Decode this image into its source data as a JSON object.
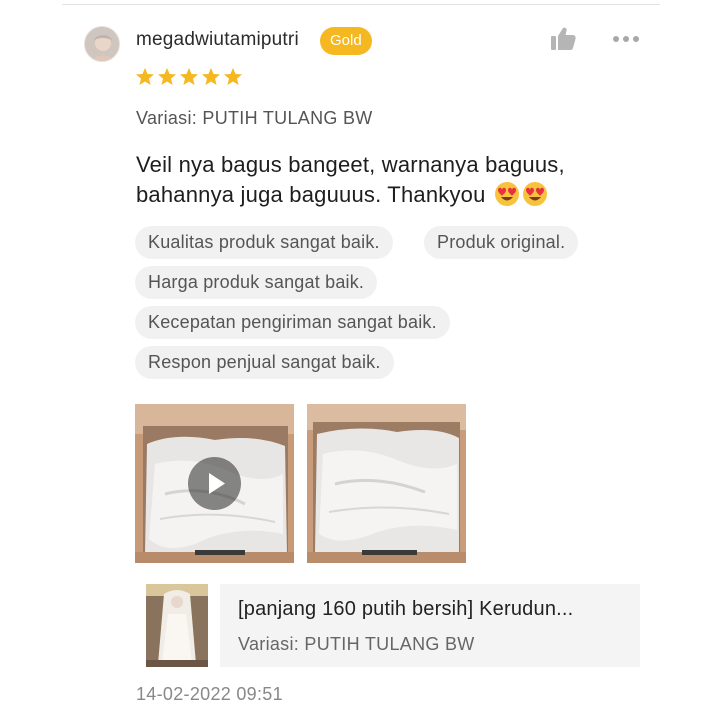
{
  "review": {
    "username": "megadwiutamiputri",
    "badge": "Gold",
    "rating": 5,
    "rating_max": 5,
    "variation": "Variasi: PUTIH TULANG BW",
    "text": "Veil nya bagus bangeet, warnanya baguus, bahannya juga baguuus. Thankyou",
    "text_emoji": "heart-eyes-emoji",
    "tags": [
      "Kualitas produk sangat baik.",
      "Produk original.",
      "Harga produk sangat baik.",
      "Kecepatan pengiriman sangat baik.",
      "Respon penjual sangat baik."
    ],
    "media": [
      {
        "kind": "video",
        "icon": "play-icon"
      },
      {
        "kind": "photo"
      }
    ],
    "product": {
      "name": "[panjang 160 putih bersih] Kerudun...",
      "variation": "Variasi: PUTIH TULANG BW"
    },
    "timestamp": "14-02-2022 09:51"
  },
  "icons": {
    "like": "thumbs-up-icon",
    "more": "more-dots-icon",
    "star": "star-icon"
  },
  "colors": {
    "badge": "#f5b821",
    "star": "#f5b821",
    "chip_bg": "#f1f1f1"
  }
}
